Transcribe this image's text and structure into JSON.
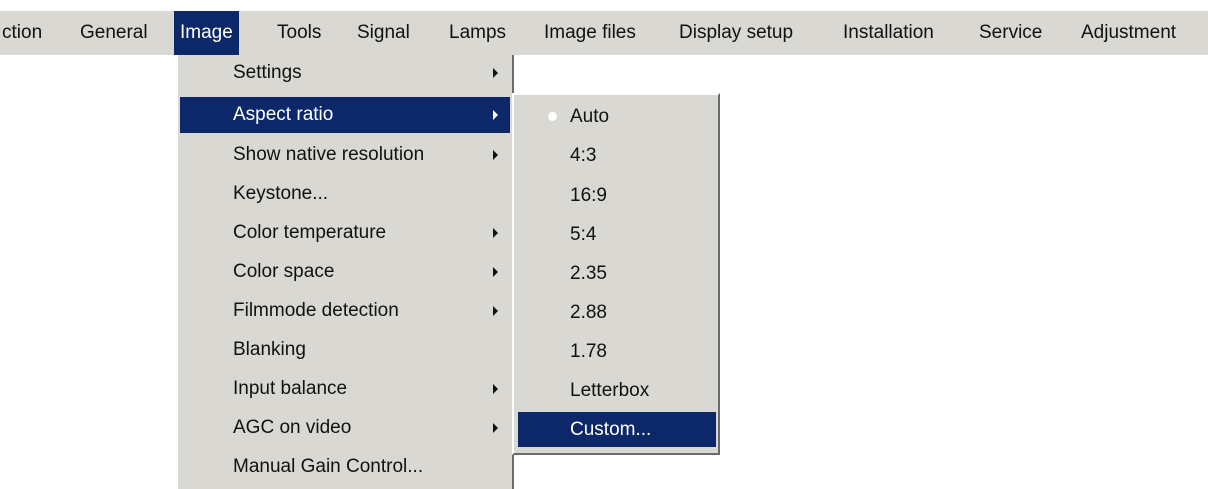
{
  "menubar": {
    "items": [
      {
        "label": "ction"
      },
      {
        "label": "General"
      },
      {
        "label": "Image"
      },
      {
        "label": "Tools"
      },
      {
        "label": "Signal"
      },
      {
        "label": "Lamps"
      },
      {
        "label": "Image files"
      },
      {
        "label": "Display setup"
      },
      {
        "label": "Installation"
      },
      {
        "label": "Service"
      },
      {
        "label": "Adjustment"
      }
    ],
    "active": "Image"
  },
  "image_menu": {
    "items": [
      {
        "label": "Settings",
        "submenu": true
      },
      {
        "label": "Aspect ratio",
        "submenu": true,
        "highlighted": true
      },
      {
        "label": "Show native resolution",
        "submenu": true
      },
      {
        "label": "Keystone...",
        "submenu": false
      },
      {
        "label": "Color temperature",
        "submenu": true
      },
      {
        "label": "Color space",
        "submenu": true
      },
      {
        "label": "Filmmode detection",
        "submenu": true
      },
      {
        "label": "Blanking",
        "submenu": false
      },
      {
        "label": "Input balance",
        "submenu": true
      },
      {
        "label": "AGC on video",
        "submenu": true
      },
      {
        "label": "Manual Gain Control...",
        "submenu": false
      }
    ]
  },
  "aspect_ratio_submenu": {
    "items": [
      {
        "label": "Auto",
        "selected": true
      },
      {
        "label": "4:3"
      },
      {
        "label": "16:9"
      },
      {
        "label": "5:4"
      },
      {
        "label": "2.35"
      },
      {
        "label": "2.88"
      },
      {
        "label": "1.78"
      },
      {
        "label": "Letterbox"
      },
      {
        "label": "Custom...",
        "highlighted": true
      }
    ]
  },
  "colors": {
    "highlight": "#0c2869",
    "menu_background": "#d9d8d3"
  },
  "icons": {
    "submenu_arrow": "triangle-right-icon",
    "radio_selected": "radio-dot-icon"
  }
}
